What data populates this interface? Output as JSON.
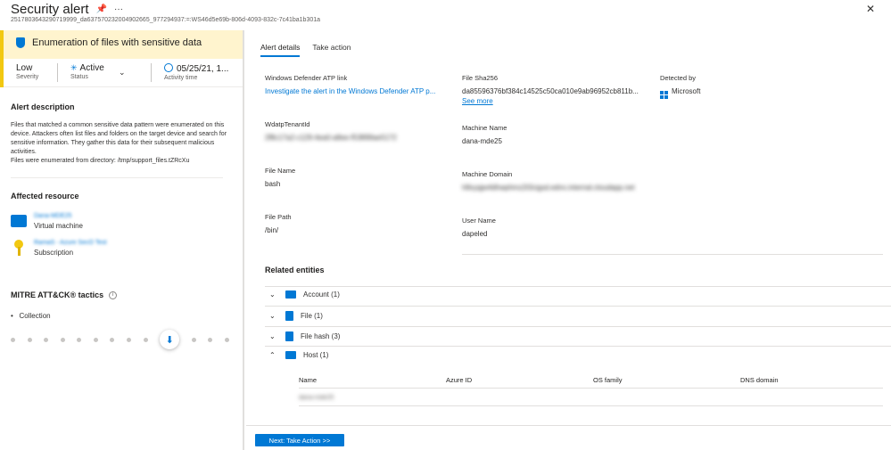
{
  "window": {
    "title": "Security alert",
    "subtitle": "2517803643290719999_da637570232004902665_977294937:=:WS46d5e69b-806d-4093-832c-7c41ba1b301a",
    "pin_icon": "pin-icon",
    "more_label": "···",
    "close_label": "✕"
  },
  "alert": {
    "name": "Enumeration of files with sensitive data",
    "severity_value": "Low",
    "severity_label": "Severity",
    "status_value": "Active",
    "status_label": "Status",
    "time_value": "05/25/21, 1...",
    "time_label": "Activity time",
    "description_title": "Alert description",
    "description": "Files that matched a common sensitive data pattern were enumerated on this device. Attackers often list files and folders on the target device and search for sensitive information. They gather this data for their subsequent malicious activities.",
    "description_extra": "Files were enumerated from directory: /tmp/support_files.tZRcXu",
    "severity_color": "#f2c811"
  },
  "affected": {
    "title": "Affected resource",
    "items": [
      {
        "name": "Dana-MDE25",
        "type": "Virtual machine",
        "icon": "vm-icon"
      },
      {
        "name": "RamaS - Azure SecO Test",
        "type": "Subscription",
        "icon": "key-icon"
      }
    ]
  },
  "mitre": {
    "title": "MITRE ATT&CK® tactics",
    "tactics": [
      "Collection"
    ]
  },
  "tabs": {
    "details": "Alert details",
    "action": "Take action"
  },
  "details": {
    "atp_link_label": "Windows Defender ATP link",
    "atp_link_value": "Investigate the alert in the Windows Defender ATP p...",
    "sha_label": "File Sha256",
    "sha_value": "da85596376bf384c14525c50ca010e9ab96952cb811b...",
    "see_more": "See more",
    "detected_label": "Detected by",
    "detected_value": "Microsoft",
    "tenant_label": "WdatpTenantId",
    "tenant_value": "2f8c17a2-c129-4ea0-a8ee-f53899ae5172",
    "machine_name_label": "Machine Name",
    "machine_name_value": "dana-mde25",
    "file_name_label": "File Name",
    "file_name_value": "bash",
    "machine_domain_label": "Machine Domain",
    "machine_domain_value": "h8xyqjw4dhwphmz2t3cigsd.ednx.internal.cloudapp.net",
    "file_path_label": "File Path",
    "file_path_value": "/bin/",
    "user_name_label": "User Name",
    "user_name_value": "dapeled"
  },
  "related": {
    "title": "Related entities",
    "entities": [
      {
        "label": "Account (1)",
        "expanded": false
      },
      {
        "label": "File (1)",
        "expanded": false
      },
      {
        "label": "File hash (3)",
        "expanded": false
      },
      {
        "label": "Host (1)",
        "expanded": true
      }
    ],
    "host_columns": [
      "Name",
      "Azure ID",
      "OS family",
      "DNS domain"
    ],
    "host_rows": [
      [
        "dana-mde25",
        "",
        "",
        ""
      ]
    ]
  },
  "footer": {
    "next_button": "Next: Take Action >>"
  }
}
